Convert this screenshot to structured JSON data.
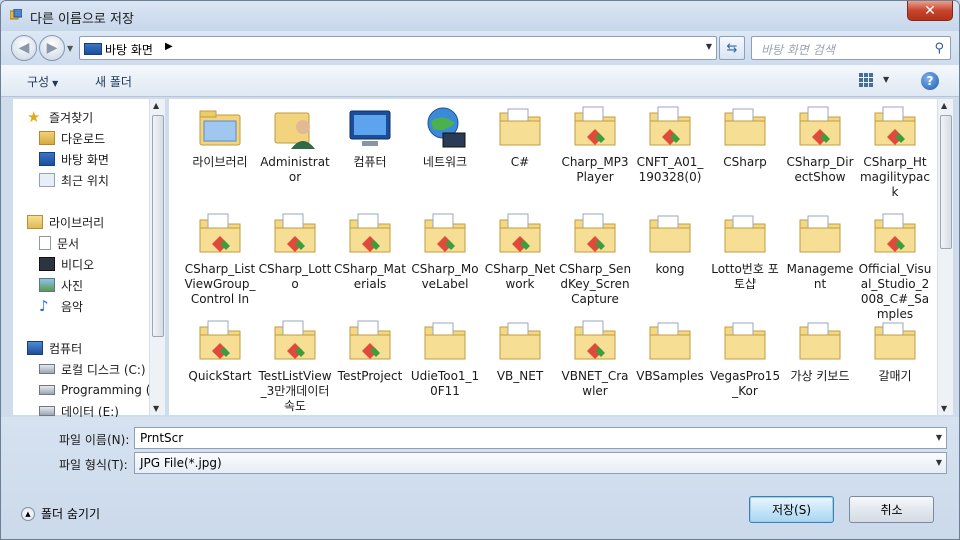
{
  "window": {
    "title": "다른 이름으로 저장",
    "close_label": "✕"
  },
  "nav": {
    "back": "◀",
    "forward": "▶",
    "address": "바탕 화면",
    "search_placeholder": "바탕 화면 검색"
  },
  "toolbar": {
    "organize": "구성",
    "new_folder": "새 폴더"
  },
  "sidebar": {
    "items": [
      {
        "label": "즐겨찾기",
        "icon": "star-icon"
      },
      {
        "label": "다운로드",
        "icon": "downloads-icon"
      },
      {
        "label": "바탕 화면",
        "icon": "desktop-icon"
      },
      {
        "label": "최근 위치",
        "icon": "recent-places-icon"
      },
      {
        "label": "라이브러리",
        "icon": "library-icon"
      },
      {
        "label": "문서",
        "icon": "documents-icon"
      },
      {
        "label": "비디오",
        "icon": "videos-icon"
      },
      {
        "label": "사진",
        "icon": "pictures-icon"
      },
      {
        "label": "음악",
        "icon": "music-icon"
      },
      {
        "label": "컴퓨터",
        "icon": "computer-icon"
      },
      {
        "label": "로컬 디스크 (C:)",
        "icon": "drive-icon"
      },
      {
        "label": "Programming (D",
        "icon": "drive-icon"
      },
      {
        "label": "데이터 (E:)",
        "icon": "drive-icon"
      }
    ]
  },
  "files": [
    {
      "label": "라이브러리",
      "type": "library"
    },
    {
      "label": "Administrator",
      "type": "user"
    },
    {
      "label": "컴퓨터",
      "type": "computer"
    },
    {
      "label": "네트워크",
      "type": "network"
    },
    {
      "label": "C#",
      "type": "folder"
    },
    {
      "label": "Charp_MP3Player",
      "type": "vsfolder"
    },
    {
      "label": "CNFT_A01_190328(0)",
      "type": "vsfolder"
    },
    {
      "label": "CSharp",
      "type": "folder"
    },
    {
      "label": "CSharp_DirectShow",
      "type": "vsfolder"
    },
    {
      "label": "CSharp_Htmagilitypack",
      "type": "vsfolder"
    },
    {
      "label": "CSharp_ListViewGroup_Control In",
      "type": "vsfolder"
    },
    {
      "label": "CSharp_Lotto",
      "type": "vsfolder"
    },
    {
      "label": "CSharp_Materials",
      "type": "vsfolder"
    },
    {
      "label": "CSharp_MoveLabel",
      "type": "vsfolder"
    },
    {
      "label": "CSharp_Network",
      "type": "vsfolder"
    },
    {
      "label": "CSharp_SendKey_ScrenCapture",
      "type": "vsfolder"
    },
    {
      "label": "kong",
      "type": "folder"
    },
    {
      "label": "Lotto번호 포토샵",
      "type": "folder"
    },
    {
      "label": "Management",
      "type": "folder"
    },
    {
      "label": "Official_Visual_Studio_2008_C#_Samples",
      "type": "vsfolder"
    },
    {
      "label": "QuickStart",
      "type": "vsfolder"
    },
    {
      "label": "TestListView_3만개데이터 속도",
      "type": "vsfolder"
    },
    {
      "label": "TestProject",
      "type": "vsfolder"
    },
    {
      "label": "UdieToo1_10F11",
      "type": "folder"
    },
    {
      "label": "VB_NET",
      "type": "folder"
    },
    {
      "label": "VBNET_Crawler",
      "type": "vsfolder"
    },
    {
      "label": "VBSamples",
      "type": "folder"
    },
    {
      "label": "VegasPro15_Kor",
      "type": "folder"
    },
    {
      "label": "가상 키보드",
      "type": "folder"
    },
    {
      "label": "갈매기",
      "type": "folder"
    }
  ],
  "form": {
    "filename_label": "파일 이름(N):",
    "filename_value": "PrntScr",
    "filetype_label": "파일 형식(T):",
    "filetype_value": "JPG File(*.jpg)"
  },
  "footer": {
    "hide_folders": "폴더 숨기기",
    "save": "저장(S)",
    "cancel": "취소"
  }
}
